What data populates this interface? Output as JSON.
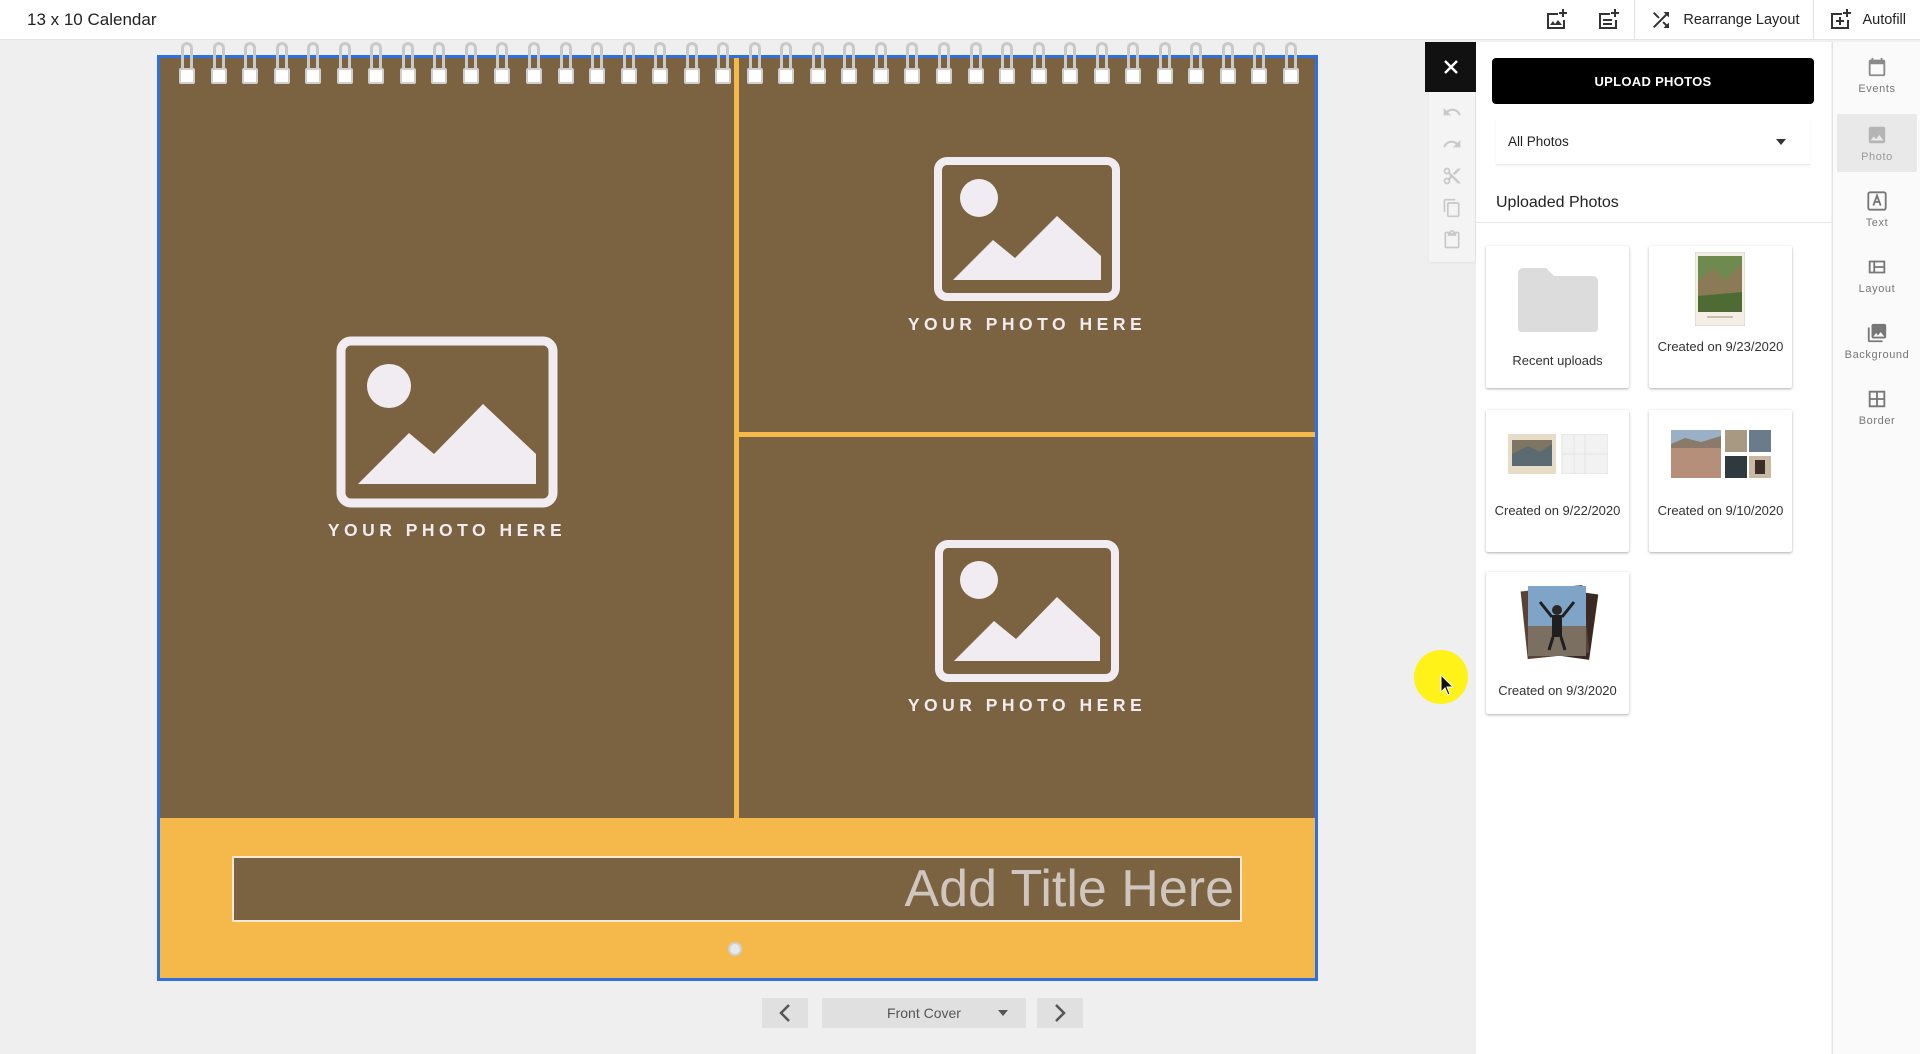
{
  "app": {
    "title": "13 x 10 Calendar"
  },
  "toolbar": {
    "add_photo_page_label": "",
    "add_page_label": "",
    "rearrange_label": "Rearrange Layout",
    "autofill_label": "Autofill"
  },
  "calendar": {
    "slot_label": "YOUR PHOTO HERE",
    "title_placeholder": "Add Title Here",
    "colors": {
      "page": "#7b6240",
      "band": "#f5b84a",
      "selection": "#2f6fe0"
    }
  },
  "pager": {
    "current": "Front Cover"
  },
  "panel": {
    "upload_label": "UPLOAD PHOTOS",
    "filter_value": "All Photos",
    "section_title": "Uploaded Photos",
    "albums": [
      {
        "caption": "Recent uploads"
      },
      {
        "caption": "Created on 9/23/2020"
      },
      {
        "caption": "Created on 9/22/2020"
      },
      {
        "caption": "Created on 9/10/2020"
      },
      {
        "caption": "Created on 9/3/2020"
      }
    ]
  },
  "rail": {
    "items": [
      {
        "label": "Events",
        "icon": "calendar-icon"
      },
      {
        "label": "Photo",
        "icon": "image-icon"
      },
      {
        "label": "Text",
        "icon": "text-icon"
      },
      {
        "label": "Layout",
        "icon": "layout-icon"
      },
      {
        "label": "Background",
        "icon": "background-icon"
      },
      {
        "label": "Border",
        "icon": "border-icon"
      }
    ]
  }
}
